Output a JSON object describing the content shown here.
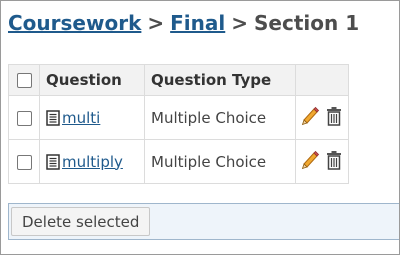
{
  "breadcrumb": {
    "items": [
      {
        "label": "Coursework",
        "link": true
      },
      {
        "label": "Final",
        "link": true
      },
      {
        "label": "Section 1",
        "link": false
      }
    ],
    "separator": ">"
  },
  "table": {
    "headers": {
      "select_all": "",
      "question": "Question",
      "question_type": "Question Type",
      "actions": ""
    },
    "rows": [
      {
        "question": "multi",
        "type": "Multiple Choice"
      },
      {
        "question": "multiply",
        "type": "Multiple Choice"
      }
    ]
  },
  "footer": {
    "delete_label": "Delete selected"
  },
  "icons": {
    "question": "document-icon",
    "edit": "pencil-icon",
    "delete": "trash-icon"
  },
  "colors": {
    "link": "#1f5a8c",
    "header_bg": "#f2f2f2",
    "footer_bg": "#eef4fa",
    "pencil": "#e8a020"
  }
}
